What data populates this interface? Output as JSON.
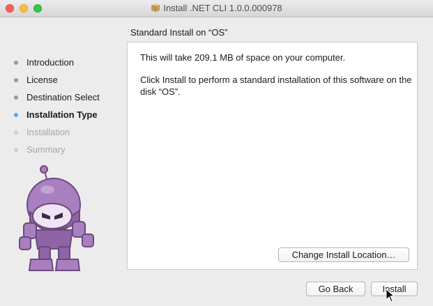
{
  "window": {
    "title": "Install .NET CLI 1.0.0.000978",
    "title_icon": "package-icon"
  },
  "heading": "Standard Install on “OS”",
  "steps": [
    {
      "label": "Introduction",
      "state": "done"
    },
    {
      "label": "License",
      "state": "done"
    },
    {
      "label": "Destination Select",
      "state": "done"
    },
    {
      "label": "Installation Type",
      "state": "active"
    },
    {
      "label": "Installation",
      "state": "pending"
    },
    {
      "label": "Summary",
      "state": "pending"
    }
  ],
  "content": {
    "space_text": "This will take 209.1 MB of space on your computer.",
    "install_text": "Click Install to perform a standard installation of this software on the disk “OS”.",
    "change_location_label": "Change Install Location…"
  },
  "buttons": {
    "back_label": "Go Back",
    "install_label": "Install"
  },
  "colors": {
    "active_step": "#5aa8e0",
    "mascot": "#a97fc0"
  }
}
